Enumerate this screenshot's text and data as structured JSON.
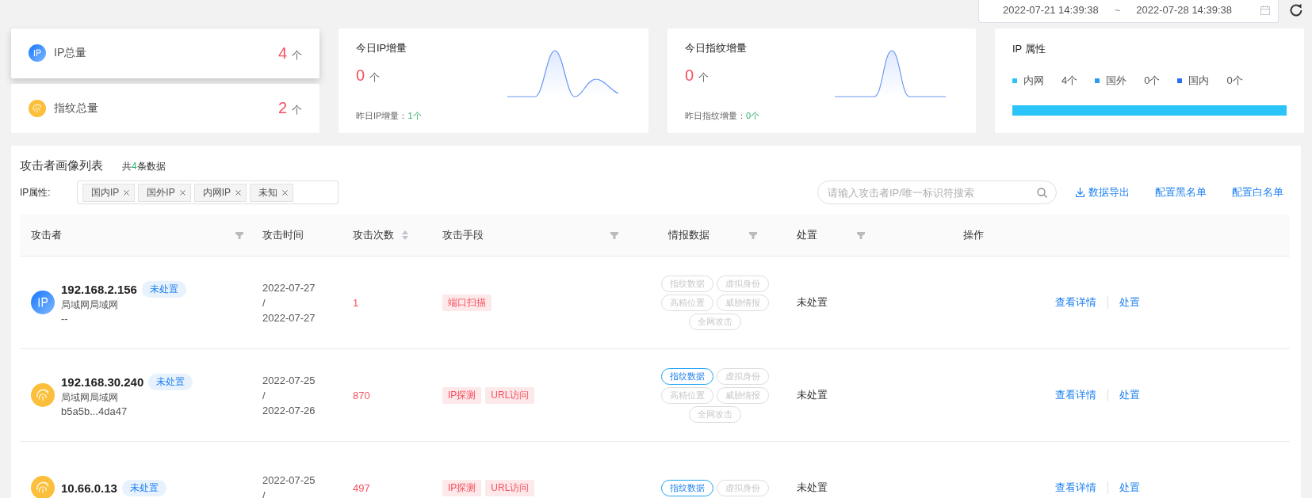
{
  "date_range": {
    "start": "2022-07-21 14:39:38",
    "separator": "~",
    "end": "2022-07-28 14:39:38"
  },
  "totals": [
    {
      "kind": "ip",
      "label": "IP总量",
      "value": "4",
      "unit": "个",
      "selected": true
    },
    {
      "kind": "fingerprint",
      "label": "指纹总量",
      "value": "2",
      "unit": "个",
      "selected": false
    }
  ],
  "increments": [
    {
      "title": "今日IP增量",
      "value": "0",
      "unit": "个",
      "yesterday_label": "昨日IP增量：",
      "yesterday_value": "1个",
      "kind": "double"
    },
    {
      "title": "今日指纹增量",
      "value": "0",
      "unit": "个",
      "yesterday_label": "昨日指纹增量：",
      "yesterday_value": "0个",
      "kind": "single"
    }
  ],
  "ip_attributes": {
    "title": "IP 属性",
    "items": [
      {
        "label": "内网",
        "count": "4个",
        "color": "#2bc4f8"
      },
      {
        "label": "国外",
        "count": "0个",
        "color": "#2d9cf0"
      },
      {
        "label": "国内",
        "count": "0个",
        "color": "#2a6ef5"
      }
    ],
    "bar": {
      "level": 1
    }
  },
  "list": {
    "title": "攻击者画像列表",
    "count_prefix": "共",
    "count": "4",
    "count_suffix": "条数据",
    "filter_label": "IP属性:",
    "filter_tags": [
      "国内IP",
      "国外IP",
      "内网IP",
      "未知"
    ],
    "search": {
      "placeholder": "请输入攻击者IP/唯一标识符搜索"
    },
    "actions": [
      "数据导出",
      "配置黑名单",
      "配置白名单"
    ],
    "columns": [
      {
        "label": "攻击者",
        "kind": "filter"
      },
      {
        "label": "攻击时间",
        "kind": "plain"
      },
      {
        "label": "攻击次数",
        "kind": "sort"
      },
      {
        "label": "攻击手段",
        "kind": "filter"
      },
      {
        "label": "情报数据",
        "kind": "filter"
      },
      {
        "label": "处置",
        "kind": "filter"
      },
      {
        "label": "操作",
        "kind": "plain"
      }
    ],
    "rows": [
      {
        "kind": "ip",
        "ip": "192.168.2.156",
        "badge": "未处置",
        "location": "局域网局域网",
        "identifier": "--",
        "date_start": "2022-07-27",
        "date_sep": "/",
        "date_end": "2022-07-27",
        "count": "1",
        "methods": [
          "端口扫描"
        ],
        "intel": [
          {
            "label": "指纹数据",
            "active": false
          },
          {
            "label": "虚拟身份",
            "active": false
          },
          {
            "label": "高精位置",
            "active": false
          },
          {
            "label": "威胁情报",
            "active": false
          },
          {
            "label": "全网攻击",
            "active": false
          }
        ],
        "status": "未处置",
        "links": [
          "查看详情",
          "处置"
        ]
      },
      {
        "kind": "fingerprint",
        "ip": "192.168.30.240",
        "badge": "未处置",
        "location": "局域网局域网",
        "identifier": "b5a5b...4da47",
        "date_start": "2022-07-25",
        "date_sep": "/",
        "date_end": "2022-07-26",
        "count": "870",
        "methods": [
          "IP探测",
          "URL访问"
        ],
        "intel": [
          {
            "label": "指纹数据",
            "active": true
          },
          {
            "label": "虚拟身份",
            "active": false
          },
          {
            "label": "高精位置",
            "active": false
          },
          {
            "label": "威胁情报",
            "active": false
          },
          {
            "label": "全网攻击",
            "active": false
          }
        ],
        "status": "未处置",
        "links": [
          "查看详情",
          "处置"
        ]
      },
      {
        "kind": "fingerprint",
        "ip": "10.66.0.13",
        "badge": "未处置",
        "date_start": "2022-07-25",
        "date_sep": "/",
        "count": "497",
        "methods": [
          "IP探测",
          "URL访问"
        ],
        "intel": [
          {
            "label": "指纹数据",
            "active": true
          },
          {
            "label": "虚拟身份",
            "active": false
          }
        ],
        "status": "未处置",
        "links": [
          "查看详情",
          "处置"
        ]
      }
    ]
  }
}
